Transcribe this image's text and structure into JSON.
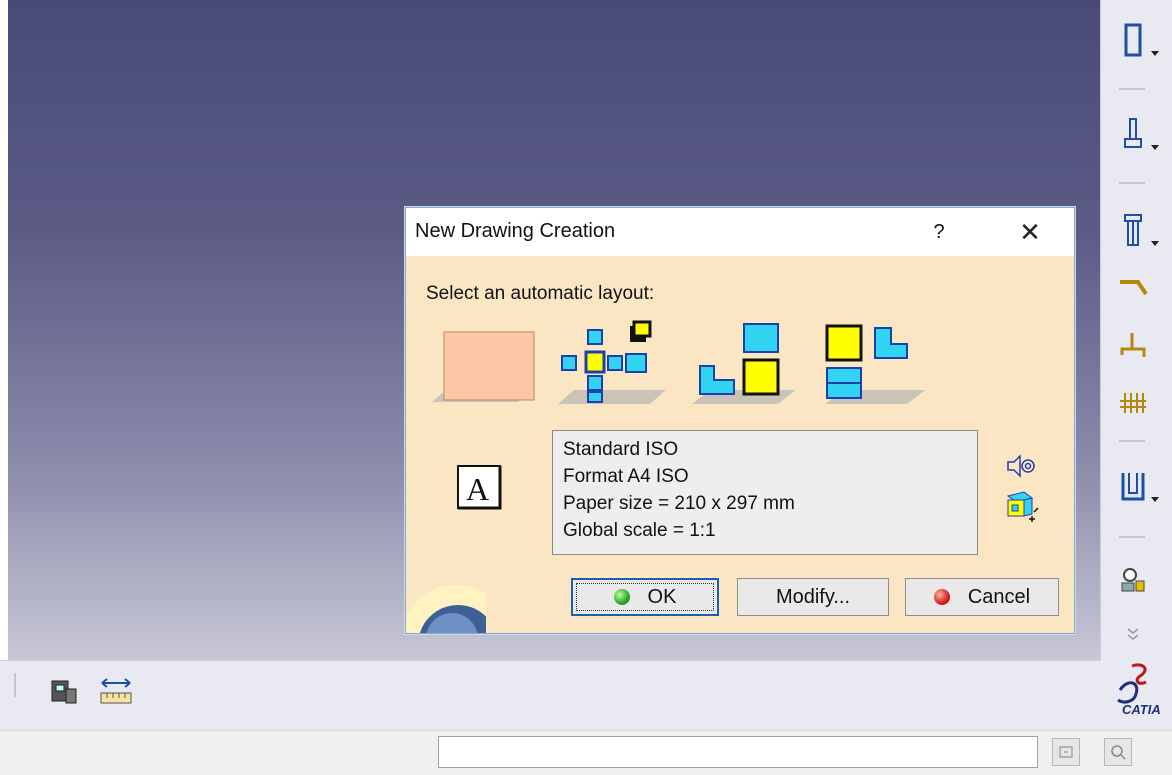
{
  "dialog": {
    "title": "New Drawing Creation",
    "help_label": "?",
    "close_label": "✕",
    "layout_label": "Select an automatic layout:",
    "layouts": [
      "empty-sheet-layout",
      "all-views-layout",
      "front-bottom-right-layout",
      "front-top-left-layout"
    ],
    "info_lines": [
      "Standard ISO",
      "Format A4 ISO",
      "Paper size = 210 x 297 mm",
      "Global scale = 1:1"
    ],
    "ok_label": "OK",
    "modify_label": "Modify...",
    "cancel_label": "Cancel"
  },
  "right_toolbar": {
    "icons": [
      "part-design-icon",
      "spec-icon",
      "column-icon",
      "sweep-icon",
      "rib-icon",
      "grid-icon",
      "frame-icon",
      "analysis-icon"
    ]
  },
  "bottom_toolbar": {
    "icons": [
      "printer-icon",
      "measure-icon"
    ]
  },
  "brand": {
    "logo_text": "CATIA"
  },
  "status_bar": {
    "command_value": ""
  },
  "colors": {
    "dialog_bg": "#fbe6c3",
    "viewport_top": "#4a4a77",
    "ok_dot": "#2aa52a",
    "cancel_dot": "#d42020",
    "accent_cyan": "#33d4f2",
    "accent_yellow": "#ffff00"
  }
}
